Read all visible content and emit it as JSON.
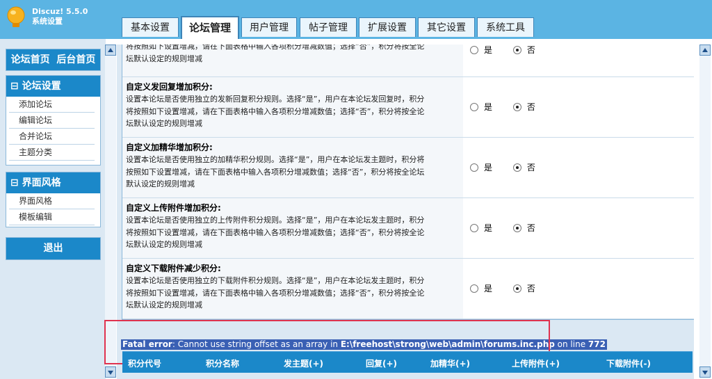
{
  "brand": {
    "name": "Discuz! 5.5.0",
    "subtitle": "系统设置"
  },
  "tabs": [
    "基本设置",
    "论坛管理",
    "用户管理",
    "帖子管理",
    "扩展设置",
    "其它设置",
    "系统工具"
  ],
  "left_menu": {
    "nav_home": "论坛首页",
    "nav_admin": "后台首页",
    "forum_settings": {
      "title": "⊟ 论坛设置",
      "items": [
        "添加论坛",
        "编辑论坛",
        "合并论坛",
        "主题分类"
      ]
    },
    "ui_style": {
      "title": "⊟ 界面风格",
      "items": [
        "界面风格",
        "模板编辑"
      ]
    },
    "logout": "退出"
  },
  "settings_rows": [
    {
      "title": "",
      "desc": [
        "",
        "将按照如下设置增减，请在下面表格中输入各项积分增减数值；选择“否”，积分将按全论",
        "坛默认设定的规则增减"
      ],
      "yes": "是",
      "no": "否"
    },
    {
      "title": "自定义发回复增加积分:",
      "desc": [
        "设置本论坛是否使用独立的发新回复积分规则。选择“是”，用户在本论坛发回复时，积分",
        "将按照如下设置增减，请在下面表格中输入各项积分增减数值；选择“否”，积分将按全论",
        "坛默认设定的规则增减"
      ],
      "yes": "是",
      "no": "否"
    },
    {
      "title": "自定义加精华增加积分:",
      "desc": [
        "设置本论坛是否使用独立的加精华积分规则。选择“是”，用户在本论坛发主题时，积分将",
        "按照如下设置增减，请在下面表格中输入各项积分增减数值；选择“否”，积分将按全论坛",
        "默认设定的规则增减"
      ],
      "yes": "是",
      "no": "否"
    },
    {
      "title": "自定义上传附件增加积分:",
      "desc": [
        "设置本论坛是否使用独立的上传附件积分规则。选择“是”，用户在本论坛发主题时，积分",
        "将按照如下设置增减，请在下面表格中输入各项积分增减数值；选择“否”，积分将按全论",
        "坛默认设定的规则增减"
      ],
      "yes": "是",
      "no": "否"
    },
    {
      "title": "自定义下载附件减少积分:",
      "desc": [
        "设置本论坛是否使用独立的下载附件积分规则。选择“是”，用户在本论坛发主题时，积分",
        "将按照如下设置增减，请在下面表格中输入各项积分增减数值；选择“否”，积分将按全论",
        "坛默认设定的规则增减"
      ],
      "yes": "是",
      "no": "否"
    }
  ],
  "error": {
    "label": "Fatal error",
    "message": ": Cannot use string offset as an array in ",
    "file": "E:\\freehost\\strong\\web\\admin\\forums.inc.php",
    "on_line": " on line ",
    "line": "772"
  },
  "table_headers": [
    "积分代号",
    "积分名称",
    "发主题(+)",
    "回复(+)",
    "加精华(+)",
    "上传附件(+)",
    "下载附件(-)"
  ],
  "colors": {
    "header": "#5bb4e3",
    "accent": "#1b88c9",
    "error_border": "#e0334f",
    "error_highlight": "#3a60b4"
  }
}
